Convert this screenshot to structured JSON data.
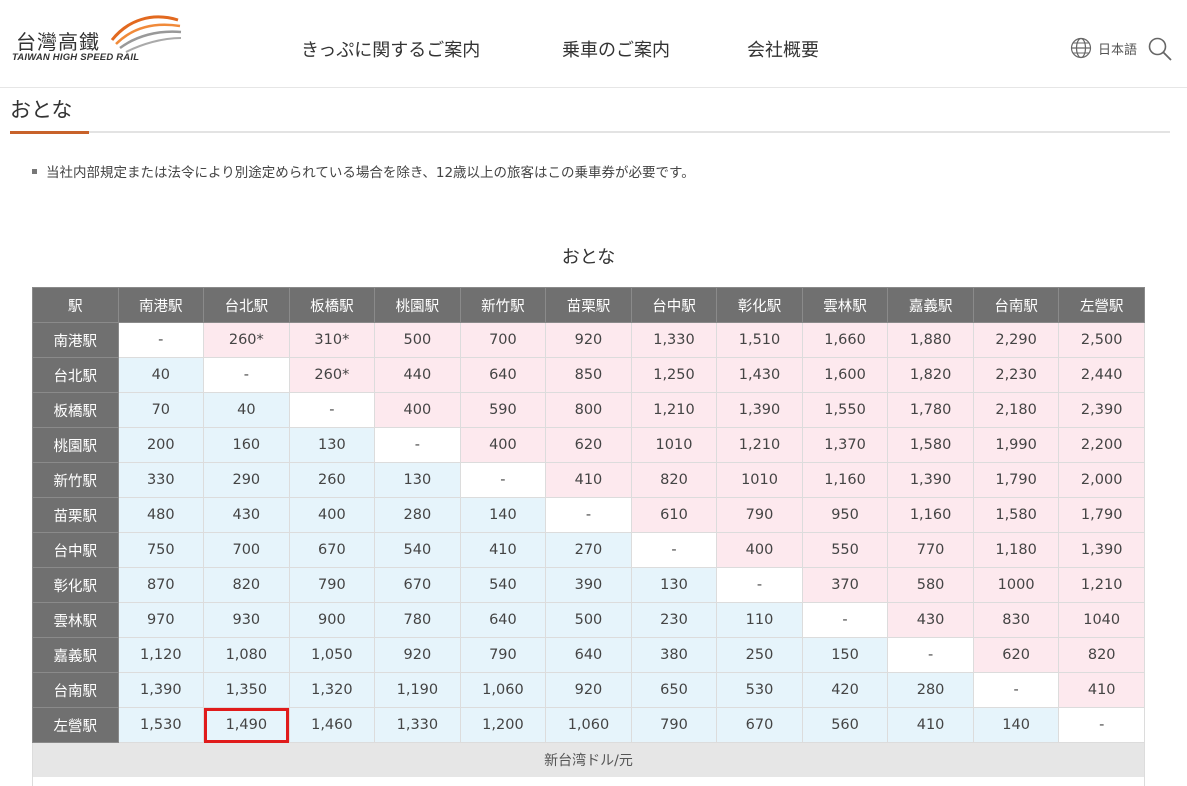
{
  "header": {
    "logo_cn": "台灣高鐵",
    "logo_en": "TAIWAN HIGH SPEED RAIL",
    "nav": [
      "きっぷに関するご案内",
      "乗車のご案内",
      "会社概要"
    ],
    "language": "日本語"
  },
  "section": {
    "title": "おとな",
    "note": "当社内部規定または法令により別途定められている場合を除き、12歳以上の旅客はこの乗車券が必要です。"
  },
  "fare_table": {
    "caption": "おとな",
    "corner": "駅",
    "stations": [
      "南港駅",
      "台北駅",
      "板橋駅",
      "桃園駅",
      "新竹駅",
      "苗栗駅",
      "台中駅",
      "彰化駅",
      "雲林駅",
      "嘉義駅",
      "台南駅",
      "左營駅"
    ],
    "rows": [
      [
        "-",
        "260*",
        "310*",
        "500",
        "700",
        "920",
        "1,330",
        "1,510",
        "1,660",
        "1,880",
        "2,290",
        "2,500"
      ],
      [
        "40",
        "-",
        "260*",
        "440",
        "640",
        "850",
        "1,250",
        "1,430",
        "1,600",
        "1,820",
        "2,230",
        "2,440"
      ],
      [
        "70",
        "40",
        "-",
        "400",
        "590",
        "800",
        "1,210",
        "1,390",
        "1,550",
        "1,780",
        "2,180",
        "2,390"
      ],
      [
        "200",
        "160",
        "130",
        "-",
        "400",
        "620",
        "1010",
        "1,210",
        "1,370",
        "1,580",
        "1,990",
        "2,200"
      ],
      [
        "330",
        "290",
        "260",
        "130",
        "-",
        "410",
        "820",
        "1010",
        "1,160",
        "1,390",
        "1,790",
        "2,000"
      ],
      [
        "480",
        "430",
        "400",
        "280",
        "140",
        "-",
        "610",
        "790",
        "950",
        "1,160",
        "1,580",
        "1,790"
      ],
      [
        "750",
        "700",
        "670",
        "540",
        "410",
        "270",
        "-",
        "400",
        "550",
        "770",
        "1,180",
        "1,390"
      ],
      [
        "870",
        "820",
        "790",
        "670",
        "540",
        "390",
        "130",
        "-",
        "370",
        "580",
        "1000",
        "1,210"
      ],
      [
        "970",
        "930",
        "900",
        "780",
        "640",
        "500",
        "230",
        "110",
        "-",
        "430",
        "830",
        "1040"
      ],
      [
        "1,120",
        "1,080",
        "1,050",
        "920",
        "790",
        "640",
        "380",
        "250",
        "150",
        "-",
        "620",
        "820"
      ],
      [
        "1,390",
        "1,350",
        "1,320",
        "1,190",
        "1,060",
        "920",
        "650",
        "530",
        "420",
        "280",
        "-",
        "410"
      ],
      [
        "1,530",
        "1,490",
        "1,460",
        "1,330",
        "1,200",
        "1,060",
        "790",
        "670",
        "560",
        "410",
        "140",
        "-"
      ]
    ],
    "footer": "新台湾ドル/元",
    "highlight": {
      "row": 11,
      "col": 1
    }
  },
  "colors": {
    "header_bg": "#707070",
    "upper_fill": "#fde9ee",
    "lower_fill": "#e6f4fb",
    "accent": "#c8622a",
    "highlight": "#e01b1b"
  }
}
